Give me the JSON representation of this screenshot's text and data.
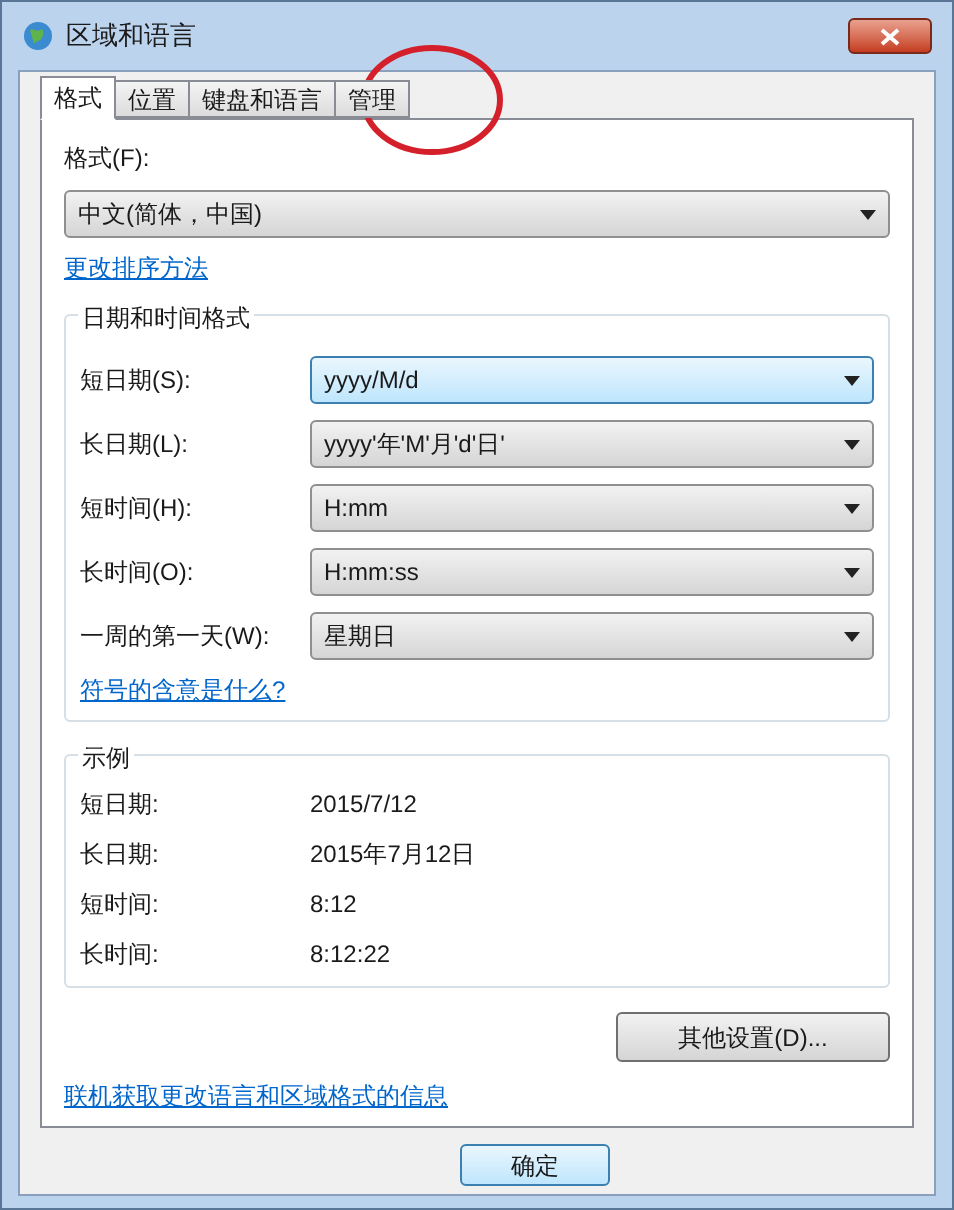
{
  "window": {
    "title": "区域和语言"
  },
  "tabs": [
    {
      "label": "格式",
      "selected": true
    },
    {
      "label": "位置",
      "selected": false
    },
    {
      "label": "键盘和语言",
      "selected": false
    },
    {
      "label": "管理",
      "selected": false
    }
  ],
  "format": {
    "label": "格式(F):",
    "value": "中文(简体，中国)",
    "link": "更改排序方法"
  },
  "date_time_formats": {
    "title": "日期和时间格式",
    "rows": [
      {
        "label": "短日期(S):",
        "value": "yyyy/M/d",
        "focused": true
      },
      {
        "label": "长日期(L):",
        "value": "yyyy'年'M'月'd'日'",
        "focused": false
      },
      {
        "label": "短时间(H):",
        "value": "H:mm",
        "focused": false
      },
      {
        "label": "长时间(O):",
        "value": "H:mm:ss",
        "focused": false
      },
      {
        "label": "一周的第一天(W):",
        "value": "星期日",
        "focused": false
      }
    ],
    "link": "符号的含意是什么?"
  },
  "examples": {
    "title": "示例",
    "rows": [
      {
        "label": "短日期:",
        "value": "2015/7/12"
      },
      {
        "label": "长日期:",
        "value": "2015年7月12日"
      },
      {
        "label": "短时间:",
        "value": "8:12"
      },
      {
        "label": "长时间:",
        "value": "8:12:22"
      }
    ]
  },
  "additional_settings_button": "其他设置(D)...",
  "online_link": "联机获取更改语言和区域格式的信息",
  "buttons": [
    "确定"
  ]
}
